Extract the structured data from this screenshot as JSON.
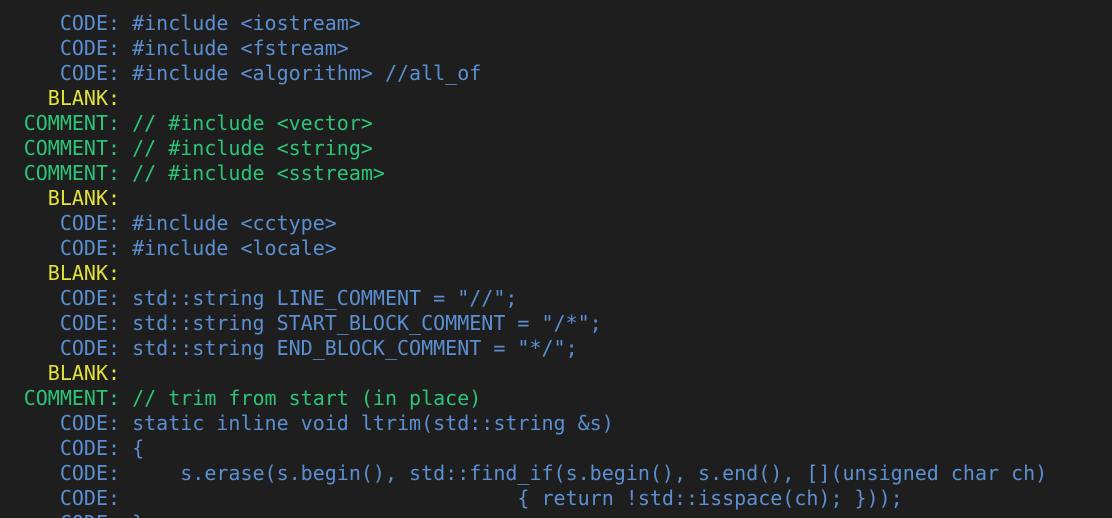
{
  "terminal": {
    "lines": [
      {
        "kind": "CODE",
        "label": "CODE",
        "text": "#include <iostream>"
      },
      {
        "kind": "CODE",
        "label": "CODE",
        "text": "#include <fstream>"
      },
      {
        "kind": "CODE",
        "label": "CODE",
        "text": "#include <algorithm> //all_of"
      },
      {
        "kind": "BLANK",
        "label": "BLANK",
        "text": ""
      },
      {
        "kind": "COMMENT",
        "label": "COMMENT",
        "text": "// #include <vector>"
      },
      {
        "kind": "COMMENT",
        "label": "COMMENT",
        "text": "// #include <string>"
      },
      {
        "kind": "COMMENT",
        "label": "COMMENT",
        "text": "// #include <sstream>"
      },
      {
        "kind": "BLANK",
        "label": "BLANK",
        "text": ""
      },
      {
        "kind": "CODE",
        "label": "CODE",
        "text": "#include <cctype>"
      },
      {
        "kind": "CODE",
        "label": "CODE",
        "text": "#include <locale>"
      },
      {
        "kind": "BLANK",
        "label": "BLANK",
        "text": ""
      },
      {
        "kind": "CODE",
        "label": "CODE",
        "text": "std::string LINE_COMMENT = \"//\";"
      },
      {
        "kind": "CODE",
        "label": "CODE",
        "text": "std::string START_BLOCK_COMMENT = \"/*\";"
      },
      {
        "kind": "CODE",
        "label": "CODE",
        "text": "std::string END_BLOCK_COMMENT = \"*/\";"
      },
      {
        "kind": "BLANK",
        "label": "BLANK",
        "text": ""
      },
      {
        "kind": "COMMENT",
        "label": "COMMENT",
        "text": "// trim from start (in place)"
      },
      {
        "kind": "CODE",
        "label": "CODE",
        "text": "static inline void ltrim(std::string &s)"
      },
      {
        "kind": "CODE",
        "label": "CODE",
        "text": "{"
      },
      {
        "kind": "CODE",
        "label": "CODE",
        "text": "    s.erase(s.begin(), std::find_if(s.begin(), s.end(), [](unsigned char ch)"
      },
      {
        "kind": "CODE",
        "label": "CODE",
        "text": "                                { return !std::isspace(ch); }));"
      },
      {
        "kind": "CODE",
        "label": "CODE",
        "text": "}"
      }
    ]
  }
}
